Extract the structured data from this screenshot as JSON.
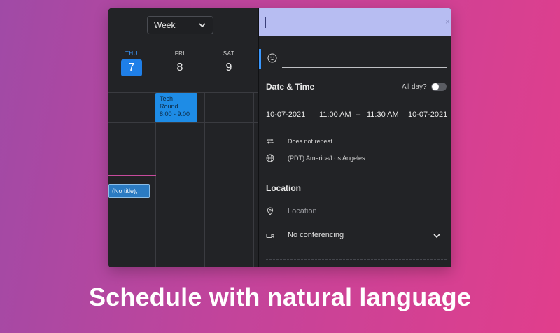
{
  "calendar": {
    "view_select": "Week",
    "days": [
      {
        "name": "THU",
        "date": "7",
        "active": true
      },
      {
        "name": "FRI",
        "date": "8",
        "active": false
      },
      {
        "name": "SAT",
        "date": "9",
        "active": false
      }
    ],
    "events": [
      {
        "title": "Tech Round",
        "time": "8:00 - 9:00"
      },
      {
        "title": "(No title),"
      }
    ],
    "colors": {
      "today": "#1f7fe8",
      "event": "#1e8ce6",
      "accent_line": "#c64b9c"
    }
  },
  "editor": {
    "title_value": "",
    "close_label": "×",
    "date_time": {
      "heading": "Date & Time",
      "all_day_label": "All day?",
      "all_day": false,
      "start_date": "10-07-2021",
      "start_time": "11:00 AM",
      "separator": "–",
      "end_time": "11:30 AM",
      "end_date": "10-07-2021"
    },
    "repeat": "Does not repeat",
    "timezone": "(PDT) America/Los Angeles",
    "location": {
      "heading": "Location",
      "placeholder": "Location"
    },
    "conferencing": "No conferencing",
    "colors": {
      "title_bg": "#b7bdf2",
      "accent": "#3a98ff"
    }
  },
  "caption": "Schedule with natural language"
}
